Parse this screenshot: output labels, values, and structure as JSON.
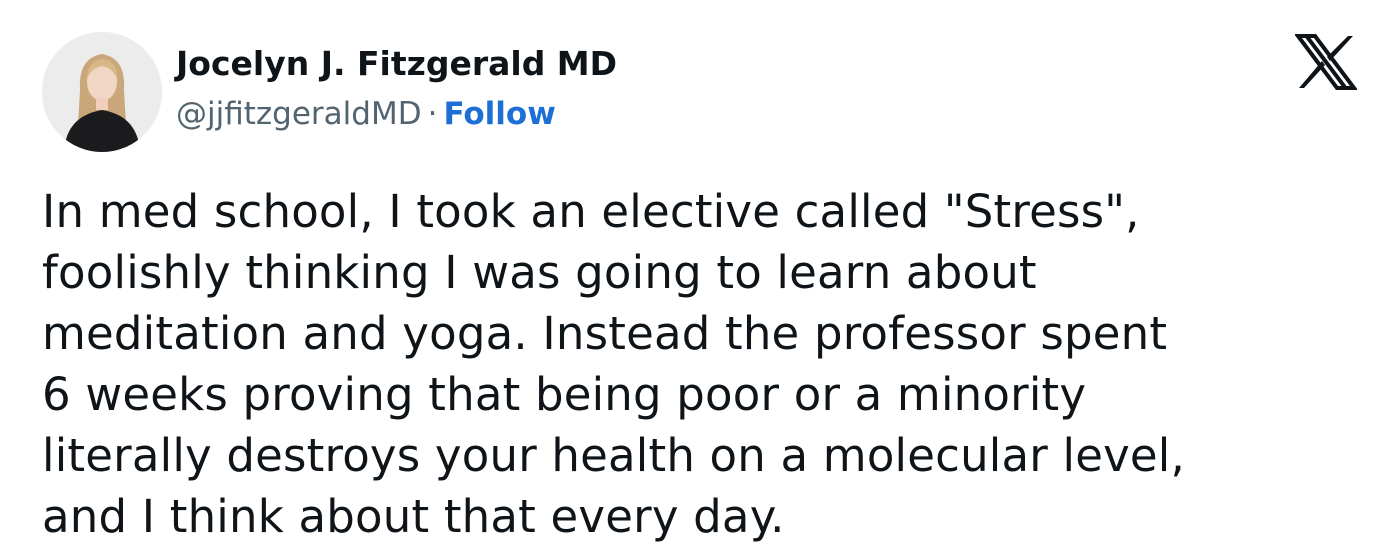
{
  "author": {
    "display_name": "Jocelyn J. Fitzgerald MD",
    "handle": "@jjfitzgeraldMD",
    "separator": "·",
    "follow_label": "Follow"
  },
  "platform": {
    "logo_icon": "x-logo-icon"
  },
  "post": {
    "lines": [
      "In med school, I took an elective called \"Stress\",",
      "foolishly thinking I was going to learn about",
      "meditation and yoga. Instead the professor spent",
      "6 weeks proving that being poor or a minority",
      "literally destroys your health on a molecular level,",
      "and I think about that every day."
    ]
  },
  "colors": {
    "text": "#0f1419",
    "secondary": "#536471",
    "link": "#1d6fd6"
  }
}
